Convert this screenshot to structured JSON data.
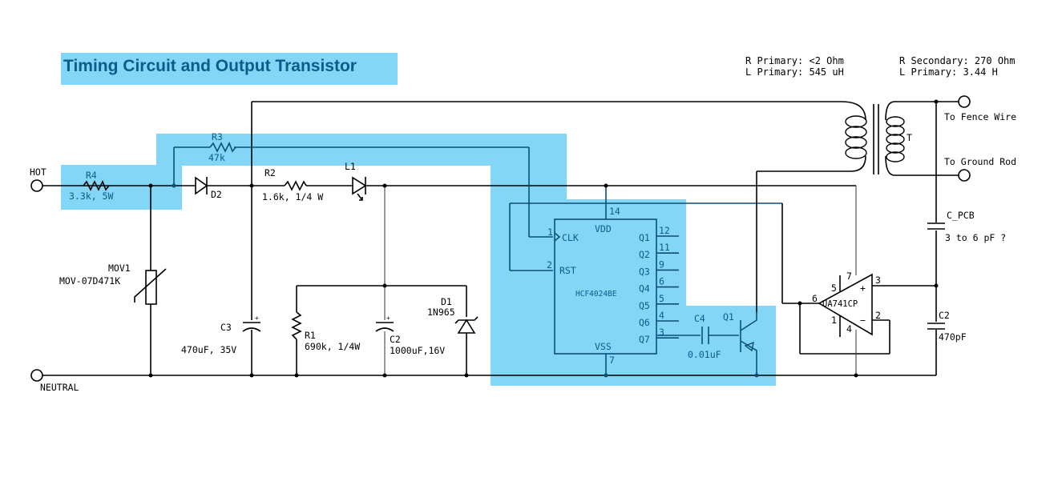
{
  "title": "Timing Circuit and Output Transistor",
  "colors": {
    "highlight": "#84d6f7",
    "highlight_text": "#0a5c8a",
    "wire": "#000000"
  },
  "transformer_specs": {
    "primary": [
      "R Primary: <2 Ohm",
      "L Primary: 545 uH"
    ],
    "secondary": [
      "R Secondary: 270 Ohm",
      "L Primary: 3.44 H"
    ]
  },
  "terminals": {
    "hot": "HOT",
    "neutral": "NEUTRAL",
    "fence": "To Fence Wire",
    "ground": "To Ground Rod"
  },
  "components": {
    "R4": {
      "ref": "R4",
      "value": "3.3k, 5W"
    },
    "R3": {
      "ref": "R3",
      "value": "47k"
    },
    "D2": {
      "ref": "D2"
    },
    "R2": {
      "ref": "R2",
      "value": "1.6k, 1/4 W"
    },
    "L1": {
      "ref": "L1"
    },
    "MOV1": {
      "ref": "MOV1",
      "value": "MOV-07D471K"
    },
    "C3": {
      "ref": "C3",
      "value": "470uF, 35V"
    },
    "R1": {
      "ref": "R1",
      "value": "690k, 1/4W"
    },
    "C2a": {
      "ref": "C2",
      "value": "1000uF,16V"
    },
    "D1": {
      "ref": "D1",
      "value": "1N965"
    },
    "C4": {
      "ref": "C4",
      "value": "0.01uF"
    },
    "Q1": {
      "ref": "Q1"
    },
    "T": {
      "ref": "T"
    },
    "CPCB": {
      "ref": "C_PCB",
      "value": "3 to 6 pF ?"
    },
    "C2b": {
      "ref": "C2",
      "value": "470pF"
    }
  },
  "ic_counter": {
    "part": "HCF4024BE",
    "pins": {
      "vdd": {
        "name": "VDD",
        "num": "14"
      },
      "vss": {
        "name": "VSS",
        "num": "7"
      },
      "clk": {
        "name": "CLK",
        "num": "1"
      },
      "rst": {
        "name": "RST",
        "num": "2"
      },
      "outputs": [
        {
          "name": "Q1",
          "num": "12"
        },
        {
          "name": "Q2",
          "num": "11"
        },
        {
          "name": "Q3",
          "num": "9"
        },
        {
          "name": "Q4",
          "num": "6"
        },
        {
          "name": "Q5",
          "num": "5"
        },
        {
          "name": "Q6",
          "num": "4"
        },
        {
          "name": "Q7",
          "num": "3"
        }
      ]
    }
  },
  "opamp": {
    "part": "UA741CP",
    "pins": {
      "out": "6",
      "v_plus": "7",
      "offset_a": "5",
      "offset_b": "1",
      "v_minus": "4",
      "in_plus": "3",
      "in_minus": "2"
    },
    "plus_sign": "+",
    "minus_sign": "−"
  }
}
